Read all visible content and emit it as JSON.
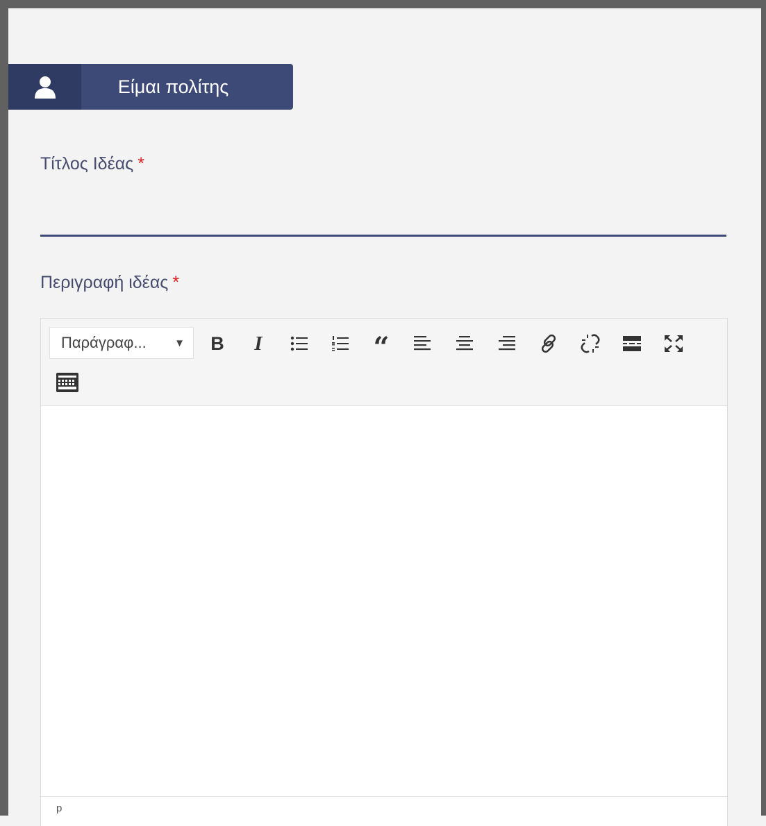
{
  "role_button": {
    "label": "Είμαι πολίτης",
    "icon": "user-icon"
  },
  "title_field": {
    "label": "Τίτλος Ιδέας",
    "required_mark": "*",
    "value": ""
  },
  "description_field": {
    "label": "Περιγραφή ιδέας",
    "required_mark": "*"
  },
  "editor": {
    "format_select": {
      "selected": "Παράγραφ..."
    },
    "toolbar_icons": [
      "bold-icon",
      "italic-icon",
      "bullet-list-icon",
      "numbered-list-icon",
      "blockquote-icon",
      "align-left-icon",
      "align-center-icon",
      "align-right-icon",
      "link-icon",
      "unlink-icon",
      "read-more-icon",
      "fullscreen-icon",
      "toolbar-toggle-icon"
    ],
    "status_path": "p"
  },
  "colors": {
    "accent": "#3d4a78",
    "accent_dark": "#303b64",
    "required": "#e41b1b",
    "label_text": "#474c6e",
    "frame": "#616161"
  }
}
